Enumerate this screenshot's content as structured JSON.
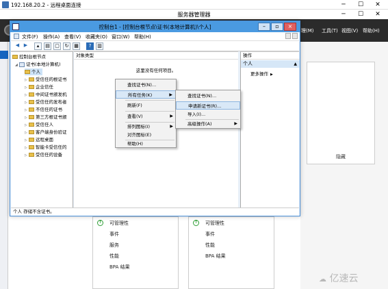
{
  "rdp": {
    "title": "192.168.20.2 - 远程桌面连接",
    "minimize": "─",
    "maximize": "☐",
    "close": "✕"
  },
  "server_manager": {
    "title": "服务器管理器",
    "menus": [
      "理(M)",
      "工具(T)",
      "视图(V)",
      "帮助(H)"
    ],
    "hide": "隐藏",
    "card1": [
      "可管理性",
      "事件",
      "服务",
      "性能",
      "BPA 结果"
    ],
    "card2": [
      "可管理性",
      "事件",
      "性能",
      "BPA 结果"
    ]
  },
  "mmc": {
    "title": "控制台1 - [控制台根节点\\证书(本地计算机)\\个人]",
    "menu": [
      "文件(F)",
      "操作(A)",
      "查看(V)",
      "收藏夹(O)",
      "窗口(W)",
      "帮助(H)"
    ],
    "tree": {
      "root": "控制台根节点",
      "certs": "证书(本地计算机)",
      "personal": "个人",
      "children": [
        "受信任的根证书",
        "企业信任",
        "中间证书颁发机",
        "受信任的发布者",
        "不信任的证书",
        "第三方根证书颁",
        "受信任人",
        "客户端身份验证",
        "远程桌面",
        "智能卡受信任的",
        "受信任的设备"
      ]
    },
    "center": {
      "header": "对象类型",
      "empty": "这里没有任何项目。"
    },
    "actions": {
      "header": "操作",
      "section": "个人",
      "more": "更多操作"
    },
    "status": "个人 存储不含证书。"
  },
  "context_menu": {
    "items": [
      "查找证书(N)...",
      "所有任务(K)",
      "刷新(F)",
      "查看(V)",
      "排列图标(I)",
      "对齐图标(E)",
      "帮助(H)"
    ]
  },
  "submenu": {
    "items": [
      "查找证书(N)...",
      "申请新证书(R)...",
      "导入(I)...",
      "高级操作(A)"
    ]
  },
  "watermark": "亿速云"
}
